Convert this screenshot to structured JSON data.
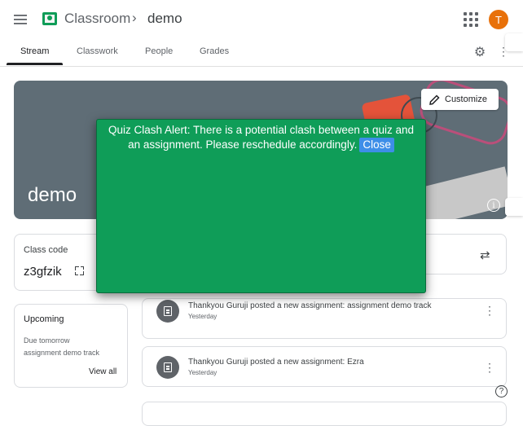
{
  "header": {
    "app_title": "Classroom",
    "separator": "›",
    "class_name": "demo",
    "avatar_letter": "T"
  },
  "tabs": [
    {
      "label": "Stream",
      "active": true
    },
    {
      "label": "Classwork",
      "active": false
    },
    {
      "label": "People",
      "active": false
    },
    {
      "label": "Grades",
      "active": false
    }
  ],
  "banner": {
    "title": "demo",
    "customize_label": "Customize"
  },
  "class_code": {
    "label": "Class code",
    "value": "z3gfzik"
  },
  "upcoming": {
    "title": "Upcoming",
    "due": "Due tomorrow",
    "item": "assignment demo track",
    "view_all": "View all"
  },
  "posts": [
    {
      "text": "Thankyou Guruji posted a new assignment: assignment demo track",
      "date": "Yesterday"
    },
    {
      "text": "Thankyou Guruji posted a new assignment: Ezra",
      "date": "Yesterday"
    }
  ],
  "alert": {
    "message": "Quiz Clash Alert: There is a potential clash between a quiz and an assignment. Please reschedule accordingly.",
    "close_label": "Close"
  },
  "colors": {
    "alert_bg": "#0f9d58",
    "close_btn": "#3d8ee8",
    "avatar": "#e8710a",
    "banner": "#5f6d76"
  },
  "icons": [
    "menu-icon",
    "classroom-logo-icon",
    "apps-grid-icon",
    "gear-icon",
    "more-vert-icon",
    "edit-pencil-icon",
    "info-icon",
    "expand-icon",
    "swap-icon",
    "assignment-icon",
    "help-icon"
  ]
}
